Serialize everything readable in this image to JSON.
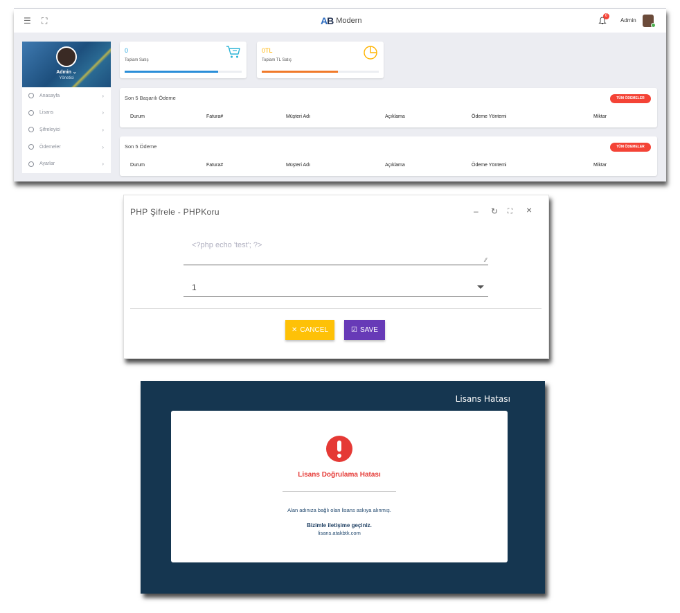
{
  "dashboard": {
    "brand": {
      "logo_a": "A",
      "logo_b": "B",
      "name": "Modern"
    },
    "notification_count": "0",
    "user_name": "Admin",
    "profile": {
      "name": "Admin",
      "role": "Yönetici"
    },
    "menu": [
      {
        "label": "Anasayfa"
      },
      {
        "label": "Lisans"
      },
      {
        "label": "Şifreleyici"
      },
      {
        "label": "Ödemeler"
      },
      {
        "label": "Ayarlar"
      }
    ],
    "stats": [
      {
        "value": "0",
        "label": "Toplam Satış",
        "color": "#2aa8e0",
        "progress_pct": 80
      },
      {
        "value": "0TL",
        "label": "Toplam TL Satış",
        "color": "#ffb300",
        "progress_pct": 65
      }
    ],
    "tables": [
      {
        "title": "Son 5 Başarılı Ödeme",
        "button": "TÜM ÖDEMELER",
        "columns": [
          "Durum",
          "Fatura#",
          "Müşteri Adı",
          "Açıklama",
          "Ödeme Yöntemi",
          "Miktar"
        ]
      },
      {
        "title": "Son 5 Ödeme",
        "button": "TÜM ÖDEMELER",
        "columns": [
          "Durum",
          "Fatura#",
          "Müşteri Adı",
          "Açıklama",
          "Ödeme Yöntemi",
          "Miktar"
        ]
      }
    ]
  },
  "modal": {
    "title": "PHP Şifrele - PHPKoru",
    "tools": {
      "minimize": "–",
      "refresh": "↻",
      "fullscreen": "⛶",
      "close": "×"
    },
    "code_placeholder": "<?php echo 'test'; ?>",
    "select_value": "1",
    "cancel_label": "CANCEL",
    "save_label": "SAVE",
    "colors": {
      "cancel": "#fec107",
      "save": "#673ab7"
    }
  },
  "license": {
    "header": "Lisans Hatası",
    "title": "Lisans Doğrulama Hatası",
    "message": "Alan adınıza bağlı olan lisans askıya alınmış.",
    "contact": "Bizimle iletişime geçiniz.",
    "site": "lisans.atakbtk.com",
    "colors": {
      "background": "#153650",
      "error": "#e53935"
    }
  }
}
